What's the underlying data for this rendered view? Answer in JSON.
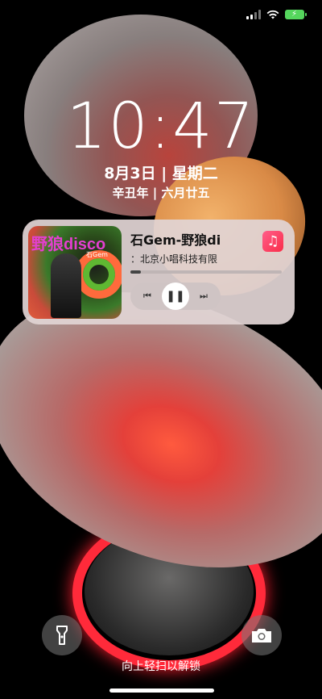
{
  "clock": {
    "time": "10:47",
    "date": "8月3日 | 星期二",
    "lunar": "辛丑年 | 六月廿五"
  },
  "music": {
    "album_title": "野狼disco",
    "album_subtitle": "石Gem",
    "song_title": "石Gem-野狼di",
    "artist": "：北京小唱科技有限",
    "progress": 0.07,
    "controls": {
      "previous": "⏮",
      "pause": "❚❚",
      "next": "⏭"
    },
    "app_icon": "♫"
  },
  "status": {
    "battery_charging": "⚡"
  },
  "bottom": {
    "hint": "向上轻扫以解锁",
    "flashlight_icon": "flashlight-icon",
    "camera_icon": "camera-icon"
  }
}
